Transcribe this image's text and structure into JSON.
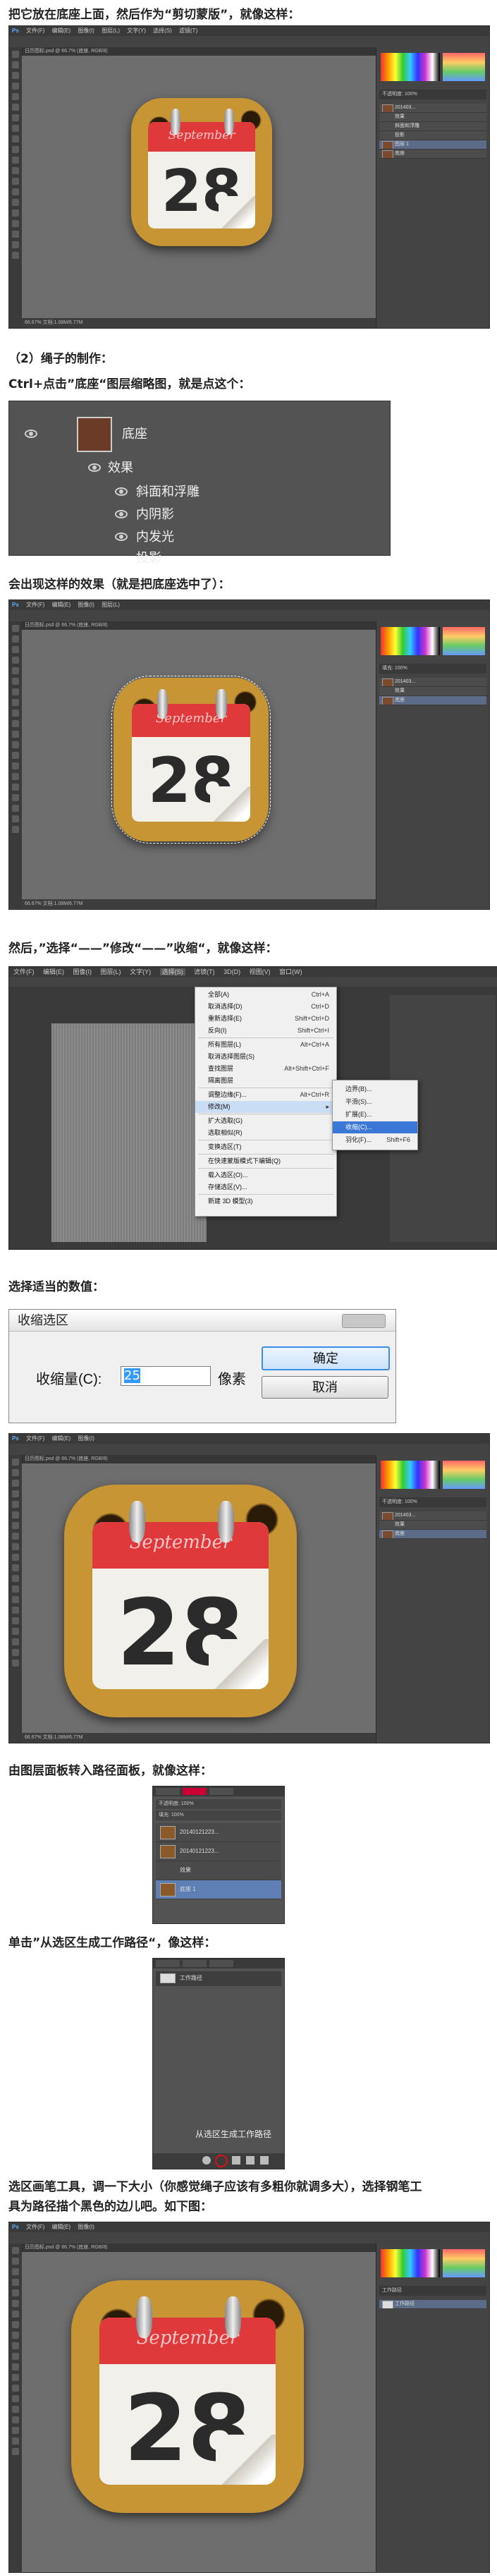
{
  "captions": {
    "c1": "把它放在底座上面，然后作为“剪切蒙版”，就像这样：",
    "c2": "（2）绳子的制作：",
    "c3": "Ctrl+点击”底座“图层缩略图，就是点这个：",
    "c4": "会出现这样的效果（就是把底座选中了）：",
    "c5": "然后，”选择“——”修改“——”收缩“，就像这样：",
    "c6": "选择适当的数值：",
    "c7": "由图层面板转入路径面板，就像这样：",
    "c8": "单击”从选区生成工作路径“，像这样：",
    "c9": "选区画笔工具，调一下大小（你感觉绳子应该有多粗你就调多大），选择钢笔工",
    "c10": "具为路径描个黑色的边儿吧。如下图："
  },
  "ps": {
    "menu": [
      "文件(F)",
      "编辑(E)",
      "图像(I)",
      "图层(L)",
      "文字(Y)",
      "选择(S)",
      "滤镜(T)",
      "3D(D)",
      "视图(V)",
      "窗口(W)",
      "帮助(H)"
    ],
    "doc_tab": "日历图标.psd @ 66.7% (底座, RGB/8)",
    "status": "66.67%   文档:1.08M/6.77M",
    "logo": "Ps"
  },
  "calendar": {
    "month": "September",
    "day": "28"
  },
  "layer_crop": {
    "layer_name": "底座",
    "fx_label": "效果",
    "effects": [
      "斜面和浮雕",
      "内阴影",
      "内发光",
      "投影"
    ]
  },
  "select_menu": {
    "items": [
      {
        "label": "全部(A)",
        "shortcut": "Ctrl+A"
      },
      {
        "label": "取消选择(D)",
        "shortcut": "Ctrl+D"
      },
      {
        "label": "重新选择(E)",
        "shortcut": "Shift+Ctrl+D"
      },
      {
        "label": "反向(I)",
        "shortcut": "Shift+Ctrl+I"
      },
      {
        "label": "所有图层(L)",
        "shortcut": "Alt+Ctrl+A"
      },
      {
        "label": "取消选择图层(S)",
        "shortcut": ""
      },
      {
        "label": "查找图层",
        "shortcut": "Alt+Shift+Ctrl+F"
      },
      {
        "label": "隔离图层",
        "shortcut": ""
      },
      {
        "label": "调整边缘(F)...",
        "shortcut": "Alt+Ctrl+R"
      },
      {
        "label": "修改(M)",
        "shortcut": "▸"
      },
      {
        "label": "扩大选取(G)",
        "shortcut": ""
      },
      {
        "label": "选取相似(R)",
        "shortcut": ""
      },
      {
        "label": "变换选区(T)",
        "shortcut": ""
      },
      {
        "label": "在快速蒙版模式下编辑(Q)",
        "shortcut": ""
      },
      {
        "label": "载入选区(O)...",
        "shortcut": ""
      },
      {
        "label": "存储选区(V)...",
        "shortcut": ""
      },
      {
        "label": "新建 3D 模型(3)",
        "shortcut": ""
      }
    ],
    "submenu": [
      {
        "label": "边界(B)...",
        "shortcut": ""
      },
      {
        "label": "平滑(S)...",
        "shortcut": ""
      },
      {
        "label": "扩展(E)...",
        "shortcut": ""
      },
      {
        "label": "收缩(C)...",
        "shortcut": ""
      },
      {
        "label": "羽化(F)...",
        "shortcut": "Shift+F6"
      }
    ],
    "top_menu": [
      "文件(F)",
      "编辑(E)",
      "图像(I)",
      "图层(L)",
      "文字(Y)",
      "选择(S)",
      "滤镜(T)",
      "3D(D)",
      "视图(V)",
      "窗口(W)"
    ]
  },
  "dialog": {
    "title": "收缩选区",
    "label": "收缩量(C):",
    "value": "25",
    "unit": "像素",
    "ok": "确定",
    "cancel": "取消"
  },
  "layers_panel": {
    "rows": [
      "201403...",
      "效果",
      "斜面和浮雕",
      "投影",
      "图层 1",
      "底座"
    ],
    "opacity": "不透明度: 100%",
    "fill": "填充: 100%"
  },
  "paths_panel": {
    "row": "工作路径",
    "tooltip": "从选区生成工作路径",
    "layer_rows": [
      "20140121223...",
      "20140121223...",
      "底座 1"
    ]
  },
  "colors": {
    "accent_red": "#e0393b",
    "leopard": "#c79533",
    "ps_dark": "#444444"
  }
}
